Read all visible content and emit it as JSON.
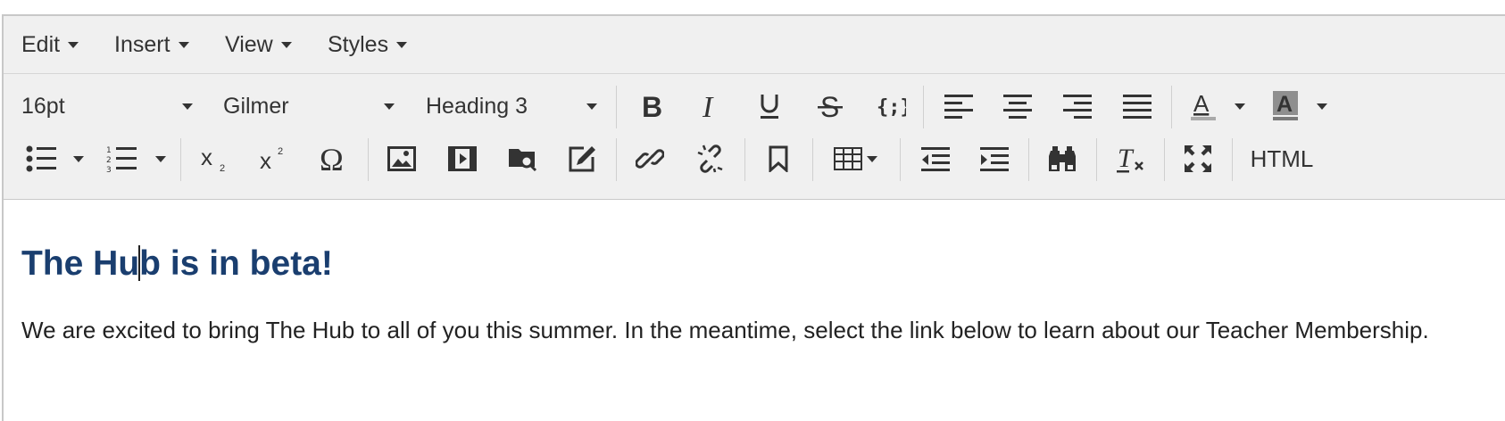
{
  "menubar": {
    "edit": "Edit",
    "insert": "Insert",
    "view": "View",
    "styles": "Styles"
  },
  "toolbar": {
    "font_size": "16pt",
    "font_family": "Gilmer",
    "block_format": "Heading 3",
    "html_label": "HTML"
  },
  "colors": {
    "heading": "#1a3e6f",
    "toolbar_bg": "#f0f0f0",
    "icon": "#333333"
  },
  "content": {
    "heading_before_cursor": "The Hu",
    "heading_after_cursor": "b is in beta!",
    "paragraph": "We are excited to bring The Hub to all of you this summer. In the meantime, select the link below to learn about our Teacher Membership."
  }
}
